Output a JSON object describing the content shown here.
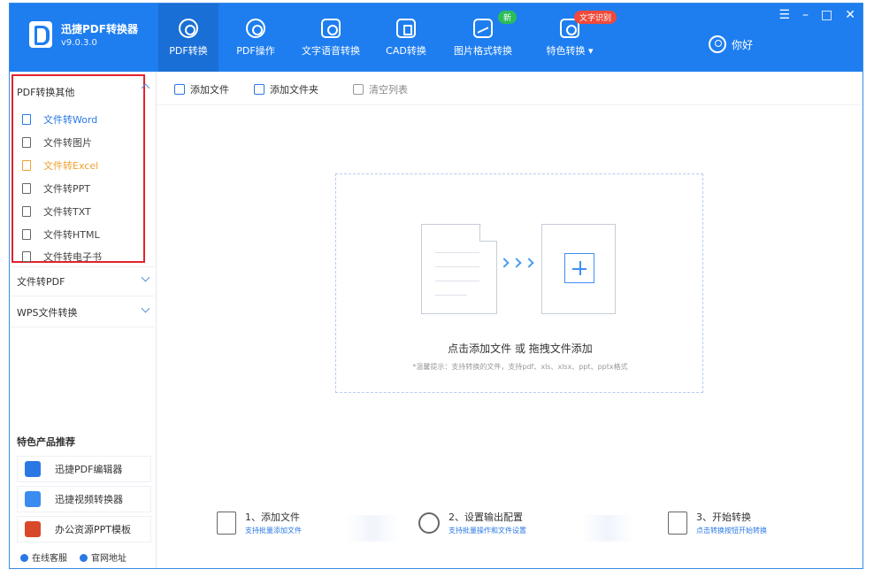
{
  "app": {
    "name": "迅捷PDF转换器",
    "version": "v9.0.3.0",
    "user_label": "你好"
  },
  "nav": {
    "tabs": [
      {
        "label": "PDF转换",
        "icon": "pdf-convert-icon",
        "active": true
      },
      {
        "label": "PDF操作",
        "icon": "pdf-operate-icon",
        "active": false
      },
      {
        "label": "文字语音转换",
        "icon": "text-voice-icon",
        "active": false
      },
      {
        "label": "CAD转换",
        "icon": "cad-convert-icon",
        "active": false
      },
      {
        "label": "图片格式转换",
        "icon": "image-convert-icon",
        "active": false,
        "badge": "新"
      },
      {
        "label": "特色转换 ▾",
        "icon": "special-convert-icon",
        "active": false,
        "badge": "文字识别"
      }
    ]
  },
  "window_controls": {
    "menu": "☰",
    "minimize": "–",
    "maximize": "□",
    "close": "✕"
  },
  "sidebar": {
    "group1": {
      "title": "PDF转换其他",
      "items": [
        {
          "label": "文件转Word",
          "state": "selected"
        },
        {
          "label": "文件转图片",
          "state": "normal"
        },
        {
          "label": "文件转Excel",
          "state": "hot"
        },
        {
          "label": "文件转PPT",
          "state": "normal"
        },
        {
          "label": "文件转TXT",
          "state": "normal"
        },
        {
          "label": "文件转HTML",
          "state": "normal"
        },
        {
          "label": "文件转电子书",
          "state": "normal"
        }
      ]
    },
    "group2": {
      "title": "文件转PDF"
    },
    "group3": {
      "title": "WPS文件转换"
    },
    "featured": {
      "title": "特色产品推荐",
      "items": [
        {
          "label": "迅捷PDF编辑器",
          "color": "#2a78e4"
        },
        {
          "label": "迅捷视频转换器",
          "color": "#3a8cf0"
        },
        {
          "label": "办公资源PPT模板",
          "color": "#d9482b"
        }
      ]
    },
    "links": {
      "service": "在线客服",
      "website": "官网地址"
    }
  },
  "toolbar": {
    "add_file": "添加文件",
    "add_folder": "添加文件夹",
    "clear_list": "清空列表"
  },
  "dropzone": {
    "main_text": "点击添加文件 或 拖拽文件添加",
    "sub_text": "*温馨提示：支持转换的文件，支持pdf、xls、xlsx、ppt、pptx格式"
  },
  "steps": [
    {
      "title": "1、添加文件",
      "sub": "支持批量添加文件"
    },
    {
      "title": "2、设置输出配置",
      "sub": "支持批量操作和文件设置"
    },
    {
      "title": "3、开始转换",
      "sub": "点击转换按钮开始转换"
    }
  ],
  "colors": {
    "accent": "#1e7ef0",
    "highlight_box": "#e0242c",
    "hot_item": "#f0a030"
  }
}
